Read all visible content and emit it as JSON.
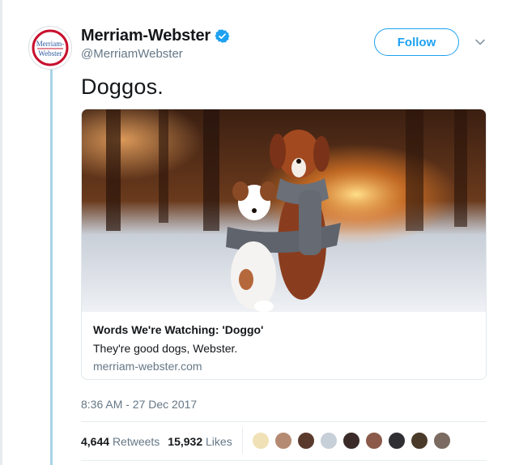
{
  "author": {
    "display_name": "Merriam-Webster",
    "handle": "@MerriamWebster",
    "logo_line1": "Merriam-",
    "logo_line2": "Webster",
    "verified": true
  },
  "follow_label": "Follow",
  "tweet_text": "Doggos.",
  "card": {
    "title": "Words We're Watching: 'Doggo'",
    "description": "They're good dogs, Webster.",
    "domain": "merriam-webster.com"
  },
  "timestamp": "8:36 AM - 27 Dec 2017",
  "stats": {
    "retweets_count": "4,644",
    "retweets_label": "Retweets",
    "likes_count": "15,932",
    "likes_label": "Likes"
  },
  "liker_avatars": [
    {
      "icon": "liker-avatar-1-icon",
      "color": "#f0e2b6"
    },
    {
      "icon": "liker-avatar-2-icon",
      "color": "#b58a72"
    },
    {
      "icon": "liker-avatar-3-icon",
      "color": "#5b3a2e"
    },
    {
      "icon": "liker-avatar-4-icon",
      "color": "#c7d0d8"
    },
    {
      "icon": "liker-avatar-5-icon",
      "color": "#3a2b28"
    },
    {
      "icon": "liker-avatar-6-icon",
      "color": "#8b5a4a"
    },
    {
      "icon": "liker-avatar-7-icon",
      "color": "#2f2f33"
    },
    {
      "icon": "liker-avatar-8-icon",
      "color": "#4a3a2a"
    },
    {
      "icon": "liker-avatar-9-icon",
      "color": "#7a6a60"
    }
  ],
  "colors": {
    "accent": "#1da1f2",
    "thread_line": "#a8d3e8",
    "secondary_text": "#657786",
    "logo_red": "#c8102e",
    "logo_blue": "#2c5aa0"
  }
}
